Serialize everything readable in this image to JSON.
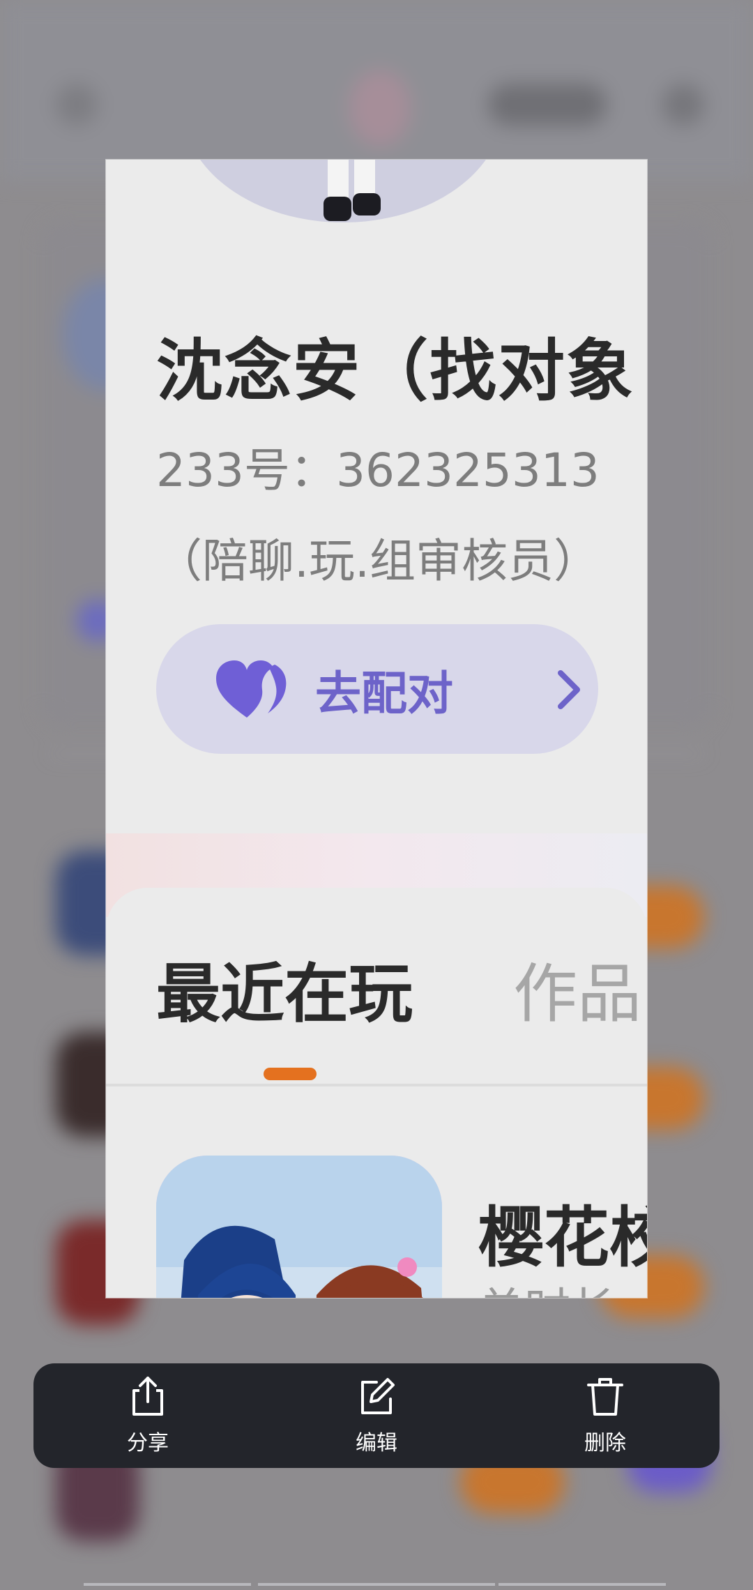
{
  "profile": {
    "name": "沈念安（找对象",
    "uid": "233号：362325313",
    "role": "（陪聊.玩.组审核员）",
    "match_button_label": "去配对"
  },
  "tabs": [
    {
      "label": "最近在玩",
      "active": true
    },
    {
      "label": "作品",
      "active": false
    }
  ],
  "recent_game": {
    "title": "樱花校",
    "subtitle": "单时长"
  },
  "actions": [
    {
      "label": "分享",
      "icon": "share-icon"
    },
    {
      "label": "编辑",
      "icon": "edit-icon"
    },
    {
      "label": "删除",
      "icon": "trash-icon"
    }
  ],
  "colors": {
    "accent": "#e4711f",
    "match_button_bg": "#d8d7ea",
    "match_button_text": "#6d63c9",
    "action_bar_bg": "#23252b"
  }
}
